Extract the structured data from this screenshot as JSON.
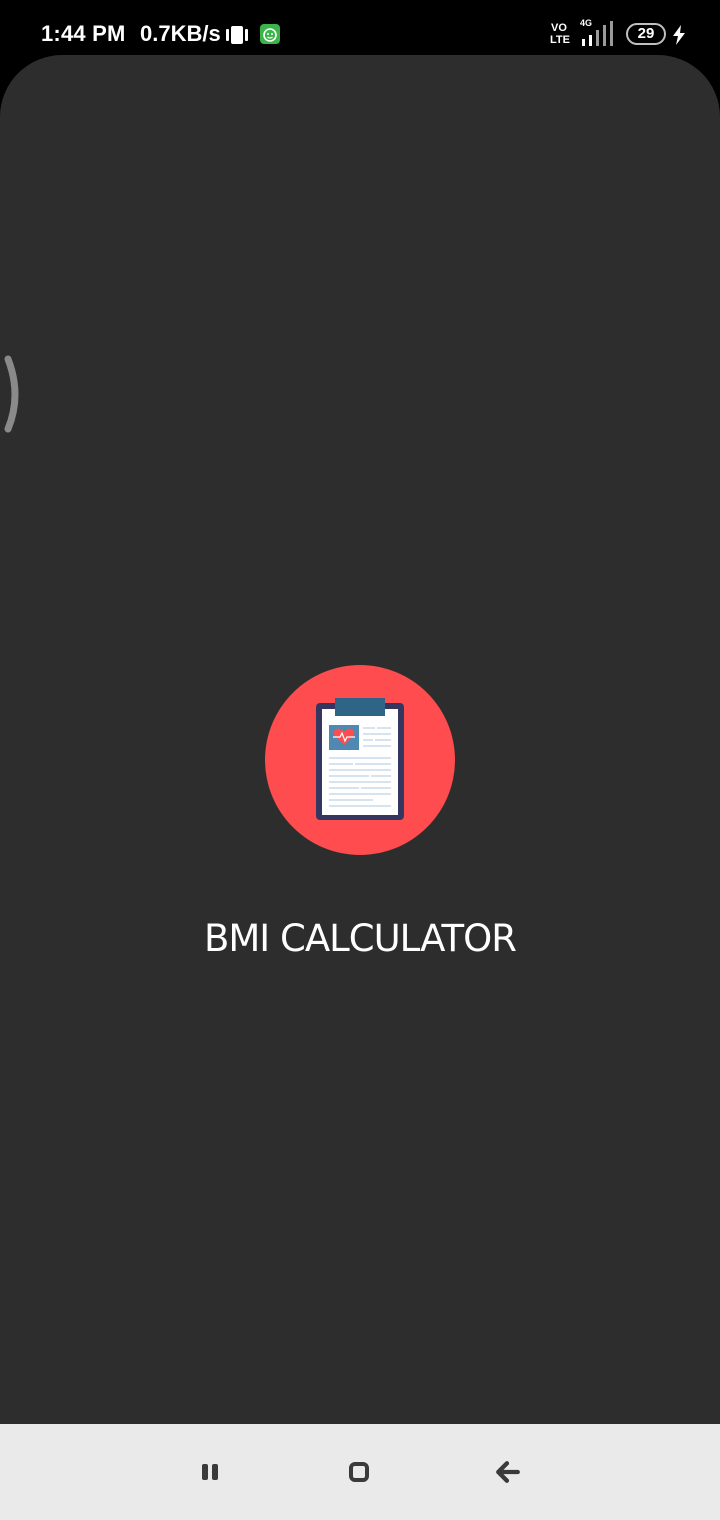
{
  "status_bar": {
    "time": "1:44 PM",
    "network_speed": "0.7KB/s",
    "volte_top": "VO",
    "volte_bottom": "LTE",
    "network_type": "4G",
    "battery_level": "29",
    "icons": [
      "vibrate-icon",
      "app-notification-icon",
      "volte-icon",
      "signal-icon",
      "battery-icon",
      "charging-icon"
    ]
  },
  "app": {
    "title": "BMI CALCULATOR",
    "logo_icon": "clipboard-heart-icon",
    "background_color": "#2d2d2d",
    "logo_background_color": "#fe4c4f"
  },
  "nav_bar": {
    "buttons": [
      "recents-icon",
      "home-icon",
      "back-arrow-icon"
    ],
    "background_color": "#eaeaea"
  }
}
